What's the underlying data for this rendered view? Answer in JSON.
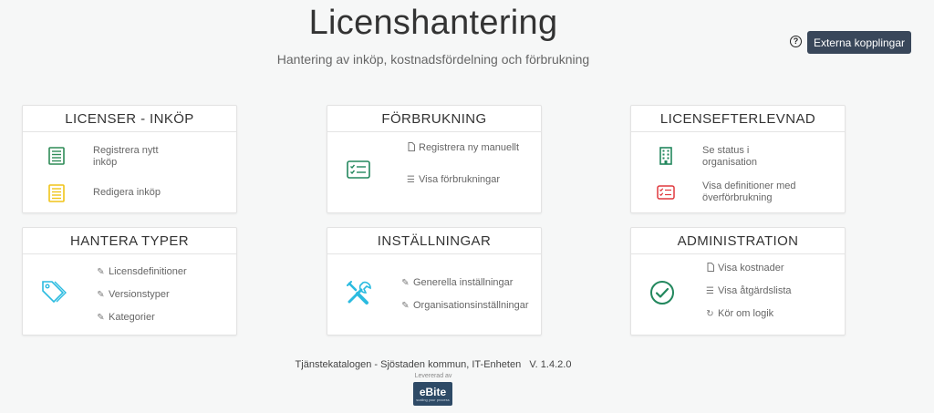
{
  "header": {
    "title": "Licenshantering",
    "subtitle": "Hantering av inköp, kostnadsfördelning och förbrukning",
    "help_icon_glyph": "?",
    "external_button_label": "Externa kopplingar"
  },
  "cards": {
    "licenses": {
      "title": "LICENSER - INKÖP",
      "items": [
        "Registrera nytt inköp",
        "Redigera inköp"
      ]
    },
    "consumption": {
      "title": "FÖRBRUKNING",
      "items": [
        "Registrera ny manuellt",
        "Visa förbrukningar"
      ]
    },
    "compliance": {
      "title": "LICENSEFTERLEVNAD",
      "items": [
        "Se status i organisation",
        "Visa definitioner med överförbrukning"
      ]
    },
    "types": {
      "title": "HANTERA TYPER",
      "items": [
        "Licensdefinitioner",
        "Versionstyper",
        "Kategorier"
      ]
    },
    "settings": {
      "title": "INSTÄLLNINGAR",
      "items": [
        "Generella inställningar",
        "Organisationsinställningar"
      ]
    },
    "admin": {
      "title": "ADMINISTRATION",
      "items": [
        "Visa kostnader",
        "Visa åtgärdslista",
        "Kör om logik"
      ]
    }
  },
  "footer": {
    "text": "Tjänstekatalogen - Sjöstaden kommun, IT-Enheten   V. 1.4.2.0",
    "delivered_by": "Levererad av",
    "logo_word": "eBite",
    "logo_tagline": "scaling your process"
  },
  "colors": {
    "button_bg": "#39475a",
    "green_icon": "#2e8b57",
    "yellow_icon": "#f0c419",
    "red_icon": "#e0393e",
    "cyan_icon": "#2bbbe0",
    "teal_icon": "#22875d"
  },
  "icons": {
    "licenses_items": [
      "green-document-list-icon",
      "yellow-document-list-icon"
    ],
    "consumption_main": "checklist-icon",
    "consumption_items": [
      "file-icon",
      "list-icon"
    ],
    "compliance_items": [
      "building-icon",
      "red-checklist-icon"
    ],
    "types_main": "tags-icon",
    "types_items": [
      "pencil-icon",
      "pencil-icon",
      "pencil-icon"
    ],
    "settings_main": "tools-icon",
    "settings_items": [
      "pencil-icon",
      "pencil-icon"
    ],
    "admin_main": "check-circle-icon",
    "admin_items": [
      "file-icon",
      "list-icon",
      "refresh-icon"
    ]
  }
}
